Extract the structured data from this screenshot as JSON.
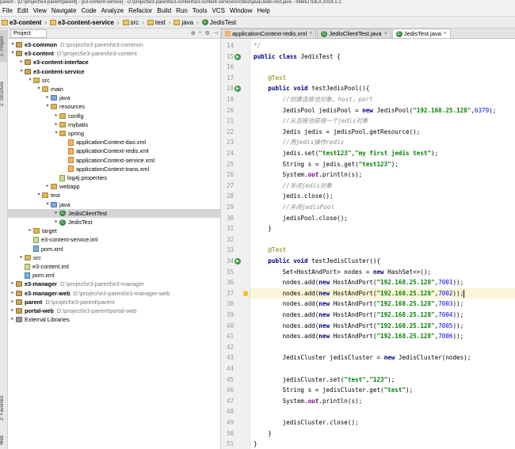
{
  "window": {
    "title": "parent - [D:\\project\\e3-parent\\parent] - [e3-content-service] - D:\\project\\e3-parent\\e3-content\\e3-content-service\\src\\test\\java\\JedisTest.java - IntelliJ IDEA 2016.1.1"
  },
  "menu": [
    "File",
    "Edit",
    "View",
    "Navigate",
    "Code",
    "Analyze",
    "Refactor",
    "Build",
    "Run",
    "Tools",
    "VCS",
    "Window",
    "Help"
  ],
  "breadcrumbs": [
    "e3-content",
    "e3-content-service",
    "src",
    "test",
    "java",
    "JedisTest"
  ],
  "left_tool_tabs": [
    "1: Project",
    "2: Structure",
    "2: Favorites",
    "Web"
  ],
  "project_panel": {
    "view_selector": "Project",
    "icons": [
      "⊕",
      "÷",
      "⚙",
      "⊣"
    ]
  },
  "tree": [
    {
      "depth": 0,
      "toggle": "▾",
      "icon": "mod",
      "text": "e3-common",
      "path": "D:\\project\\e3-parent\\e3-common",
      "bold": true
    },
    {
      "depth": 0,
      "toggle": "▾",
      "icon": "mod",
      "text": "e3-content",
      "path": "D:\\project\\e3-parent\\e3-content",
      "bold": true
    },
    {
      "depth": 1,
      "toggle": "▸",
      "icon": "mod",
      "text": "e3-content-interface",
      "path": "",
      "bold": true
    },
    {
      "depth": 1,
      "toggle": "▾",
      "icon": "mod",
      "text": "e3-content-service",
      "path": "",
      "bold": true
    },
    {
      "depth": 2,
      "toggle": "▾",
      "icon": "fold",
      "text": "src",
      "path": ""
    },
    {
      "depth": 3,
      "toggle": "▾",
      "icon": "fold",
      "text": "main",
      "path": ""
    },
    {
      "depth": 4,
      "toggle": "▸",
      "icon": "blue",
      "text": "java",
      "path": ""
    },
    {
      "depth": 4,
      "toggle": "▾",
      "icon": "fold",
      "text": "resources",
      "path": ""
    },
    {
      "depth": 5,
      "toggle": "▸",
      "icon": "fold",
      "text": "config",
      "path": ""
    },
    {
      "depth": 5,
      "toggle": "▸",
      "icon": "fold",
      "text": "mybatis",
      "path": ""
    },
    {
      "depth": 5,
      "toggle": "▾",
      "icon": "fold",
      "text": "spring",
      "path": ""
    },
    {
      "depth": 6,
      "toggle": "",
      "icon": "xml",
      "text": "applicationContext-dao.xml",
      "path": ""
    },
    {
      "depth": 6,
      "toggle": "",
      "icon": "xml",
      "text": "applicationContext-redis.xml",
      "path": ""
    },
    {
      "depth": 6,
      "toggle": "",
      "icon": "xml",
      "text": "applicationContext-service.xml",
      "path": ""
    },
    {
      "depth": 6,
      "toggle": "",
      "icon": "xml",
      "text": "applicationContext-trans.xml",
      "path": ""
    },
    {
      "depth": 5,
      "toggle": "",
      "icon": "prop",
      "text": "log4j.properties",
      "path": ""
    },
    {
      "depth": 4,
      "toggle": "▸",
      "icon": "fold",
      "text": "webapp",
      "path": ""
    },
    {
      "depth": 3,
      "toggle": "▾",
      "icon": "fold",
      "text": "test",
      "path": ""
    },
    {
      "depth": 4,
      "toggle": "▾",
      "icon": "blue",
      "text": "java",
      "path": ""
    },
    {
      "depth": 5,
      "toggle": "▸",
      "icon": "cls",
      "text": "JedisClientTest",
      "path": "",
      "sel": true
    },
    {
      "depth": 5,
      "toggle": "▸",
      "icon": "cls",
      "text": "JedisTest",
      "path": ""
    },
    {
      "depth": 2,
      "toggle": "▸",
      "icon": "fold",
      "text": "target",
      "path": ""
    },
    {
      "depth": 2,
      "toggle": "",
      "icon": "lib",
      "text": "e3-content-service.iml",
      "path": ""
    },
    {
      "depth": 2,
      "toggle": "",
      "icon": "m",
      "text": "pom.xml",
      "path": ""
    },
    {
      "depth": 1,
      "toggle": "▸",
      "icon": "fold",
      "text": "src",
      "path": ""
    },
    {
      "depth": 1,
      "toggle": "",
      "icon": "lib",
      "text": "e3-content.iml",
      "path": ""
    },
    {
      "depth": 1,
      "toggle": "",
      "icon": "m",
      "text": "pom.xml",
      "path": ""
    },
    {
      "depth": 0,
      "toggle": "▸",
      "icon": "mod",
      "text": "e3-manager",
      "path": "D:\\project\\e3-parent\\e3-manager",
      "bold": true
    },
    {
      "depth": 0,
      "toggle": "▸",
      "icon": "mod",
      "text": "e3-manager-web",
      "path": "D:\\project\\e3-parent\\e3-manager-web",
      "bold": true
    },
    {
      "depth": 0,
      "toggle": "▸",
      "icon": "mod",
      "text": "parent",
      "path": "D:\\project\\e3-parent\\parent",
      "bold": true
    },
    {
      "depth": 0,
      "toggle": "▸",
      "icon": "mod",
      "text": "portal-web",
      "path": "D:\\project\\e3-parent\\portal-web",
      "bold": true
    },
    {
      "depth": 0,
      "toggle": "▸",
      "icon": "libs",
      "text": "External Libraries",
      "path": ""
    }
  ],
  "editor_tabs": [
    {
      "label": "applicationContext-redis.xml",
      "icon": "xml",
      "active": false
    },
    {
      "label": "JedisClientTest.java",
      "icon": "java",
      "active": false
    },
    {
      "label": "JedisTest.java",
      "icon": "java",
      "active": true
    }
  ],
  "code_lines": [
    {
      "n": "14",
      "html": "<span class='c'>*/</span>"
    },
    {
      "n": "15",
      "html": "<span class='k'>public class</span> JedisTest {",
      "run": true
    },
    {
      "n": "16",
      "html": ""
    },
    {
      "n": "17",
      "html": "    <span class='a'>@Test</span>"
    },
    {
      "n": "18",
      "html": "    <span class='k'>public void</span> testJedisPool(){",
      "run": true
    },
    {
      "n": "19",
      "html": "        <span class='c'>//创建连接池对象，host，port</span>"
    },
    {
      "n": "20",
      "html": "        JedisPool jedisPool = <span class='k'>new</span> JedisPool(<span class='s'>\"192.168.25.128\"</span>,<span class='n'>6379</span>);"
    },
    {
      "n": "21",
      "html": "        <span class='c'>//从连接池获得一个jedis对象</span>"
    },
    {
      "n": "22",
      "html": "        Jedis jedis = jedisPool.getResource();"
    },
    {
      "n": "23",
      "html": "        <span class='c'>//用jedis操作redis</span>"
    },
    {
      "n": "24",
      "html": "        jedis.set(<span class='s'>\"test123\"</span>,<span class='s'>\"my first jedis test\"</span>);"
    },
    {
      "n": "25",
      "html": "        String s = jedis.get(<span class='s'>\"test123\"</span>);"
    },
    {
      "n": "26",
      "html": "        System.<span class='f'>out</span>.println(s);"
    },
    {
      "n": "27",
      "html": "        <span class='c'>//关闭jedis对象</span>"
    },
    {
      "n": "28",
      "html": "        jedis.close();"
    },
    {
      "n": "29",
      "html": "        <span class='c'>//关闭jedisPool</span>"
    },
    {
      "n": "30",
      "html": "        jedisPool.close();"
    },
    {
      "n": "31",
      "html": "    }"
    },
    {
      "n": "32",
      "html": ""
    },
    {
      "n": "33",
      "html": "    <span class='a'>@Test</span>"
    },
    {
      "n": "34",
      "html": "    <span class='k'>public void</span> testJedisCluster(){",
      "run": true
    },
    {
      "n": "35",
      "html": "        Set&lt;HostAndPort&gt; nodes = <span class='k'>new</span> HashSet&lt;&gt;();"
    },
    {
      "n": "36",
      "html": "        nodes.add(<span class='k'>new</span> HostAndPort(<span class='s'>\"192.168.25.128\"</span>,<span class='n'>7001</span>));"
    },
    {
      "n": "37",
      "html": "        nodes.add(<span class='k'>new</span> HostAndPort(<span class='s'>\"192.168.25.128\"</span>,<span class='n'>7002</span>));<span class='caret'></span>",
      "cur": true,
      "bulb": true
    },
    {
      "n": "38",
      "html": "        nodes.add(<span class='k'>new</span> HostAndPort(<span class='s'>\"192.168.25.128\"</span>,<span class='n'>7003</span>));"
    },
    {
      "n": "39",
      "html": "        nodes.add(<span class='k'>new</span> HostAndPort(<span class='s'>\"192.168.25.128\"</span>,<span class='n'>7004</span>));"
    },
    {
      "n": "40",
      "html": "        nodes.add(<span class='k'>new</span> HostAndPort(<span class='s'>\"192.168.25.128\"</span>,<span class='n'>7005</span>));"
    },
    {
      "n": "41",
      "html": "        nodes.add(<span class='k'>new</span> HostAndPort(<span class='s'>\"192.168.25.128\"</span>,<span class='n'>7006</span>));"
    },
    {
      "n": "42",
      "html": ""
    },
    {
      "n": "43",
      "html": "        JedisCluster jedisCluster = <span class='k'>new</span> JedisCluster(nodes);"
    },
    {
      "n": "44",
      "html": ""
    },
    {
      "n": "45",
      "html": "        jedisCluster.set(<span class='s'>\"test\"</span>,<span class='s'>\"123\"</span>);"
    },
    {
      "n": "46",
      "html": "        String s = jedisCluster.get(<span class='s'>\"test\"</span>);"
    },
    {
      "n": "47",
      "html": "        System.<span class='f'>out</span>.println(s);"
    },
    {
      "n": "48",
      "html": ""
    },
    {
      "n": "49",
      "html": "        jedisCluster.close();"
    },
    {
      "n": "50",
      "html": "    }"
    },
    {
      "n": "51",
      "html": "}"
    }
  ]
}
